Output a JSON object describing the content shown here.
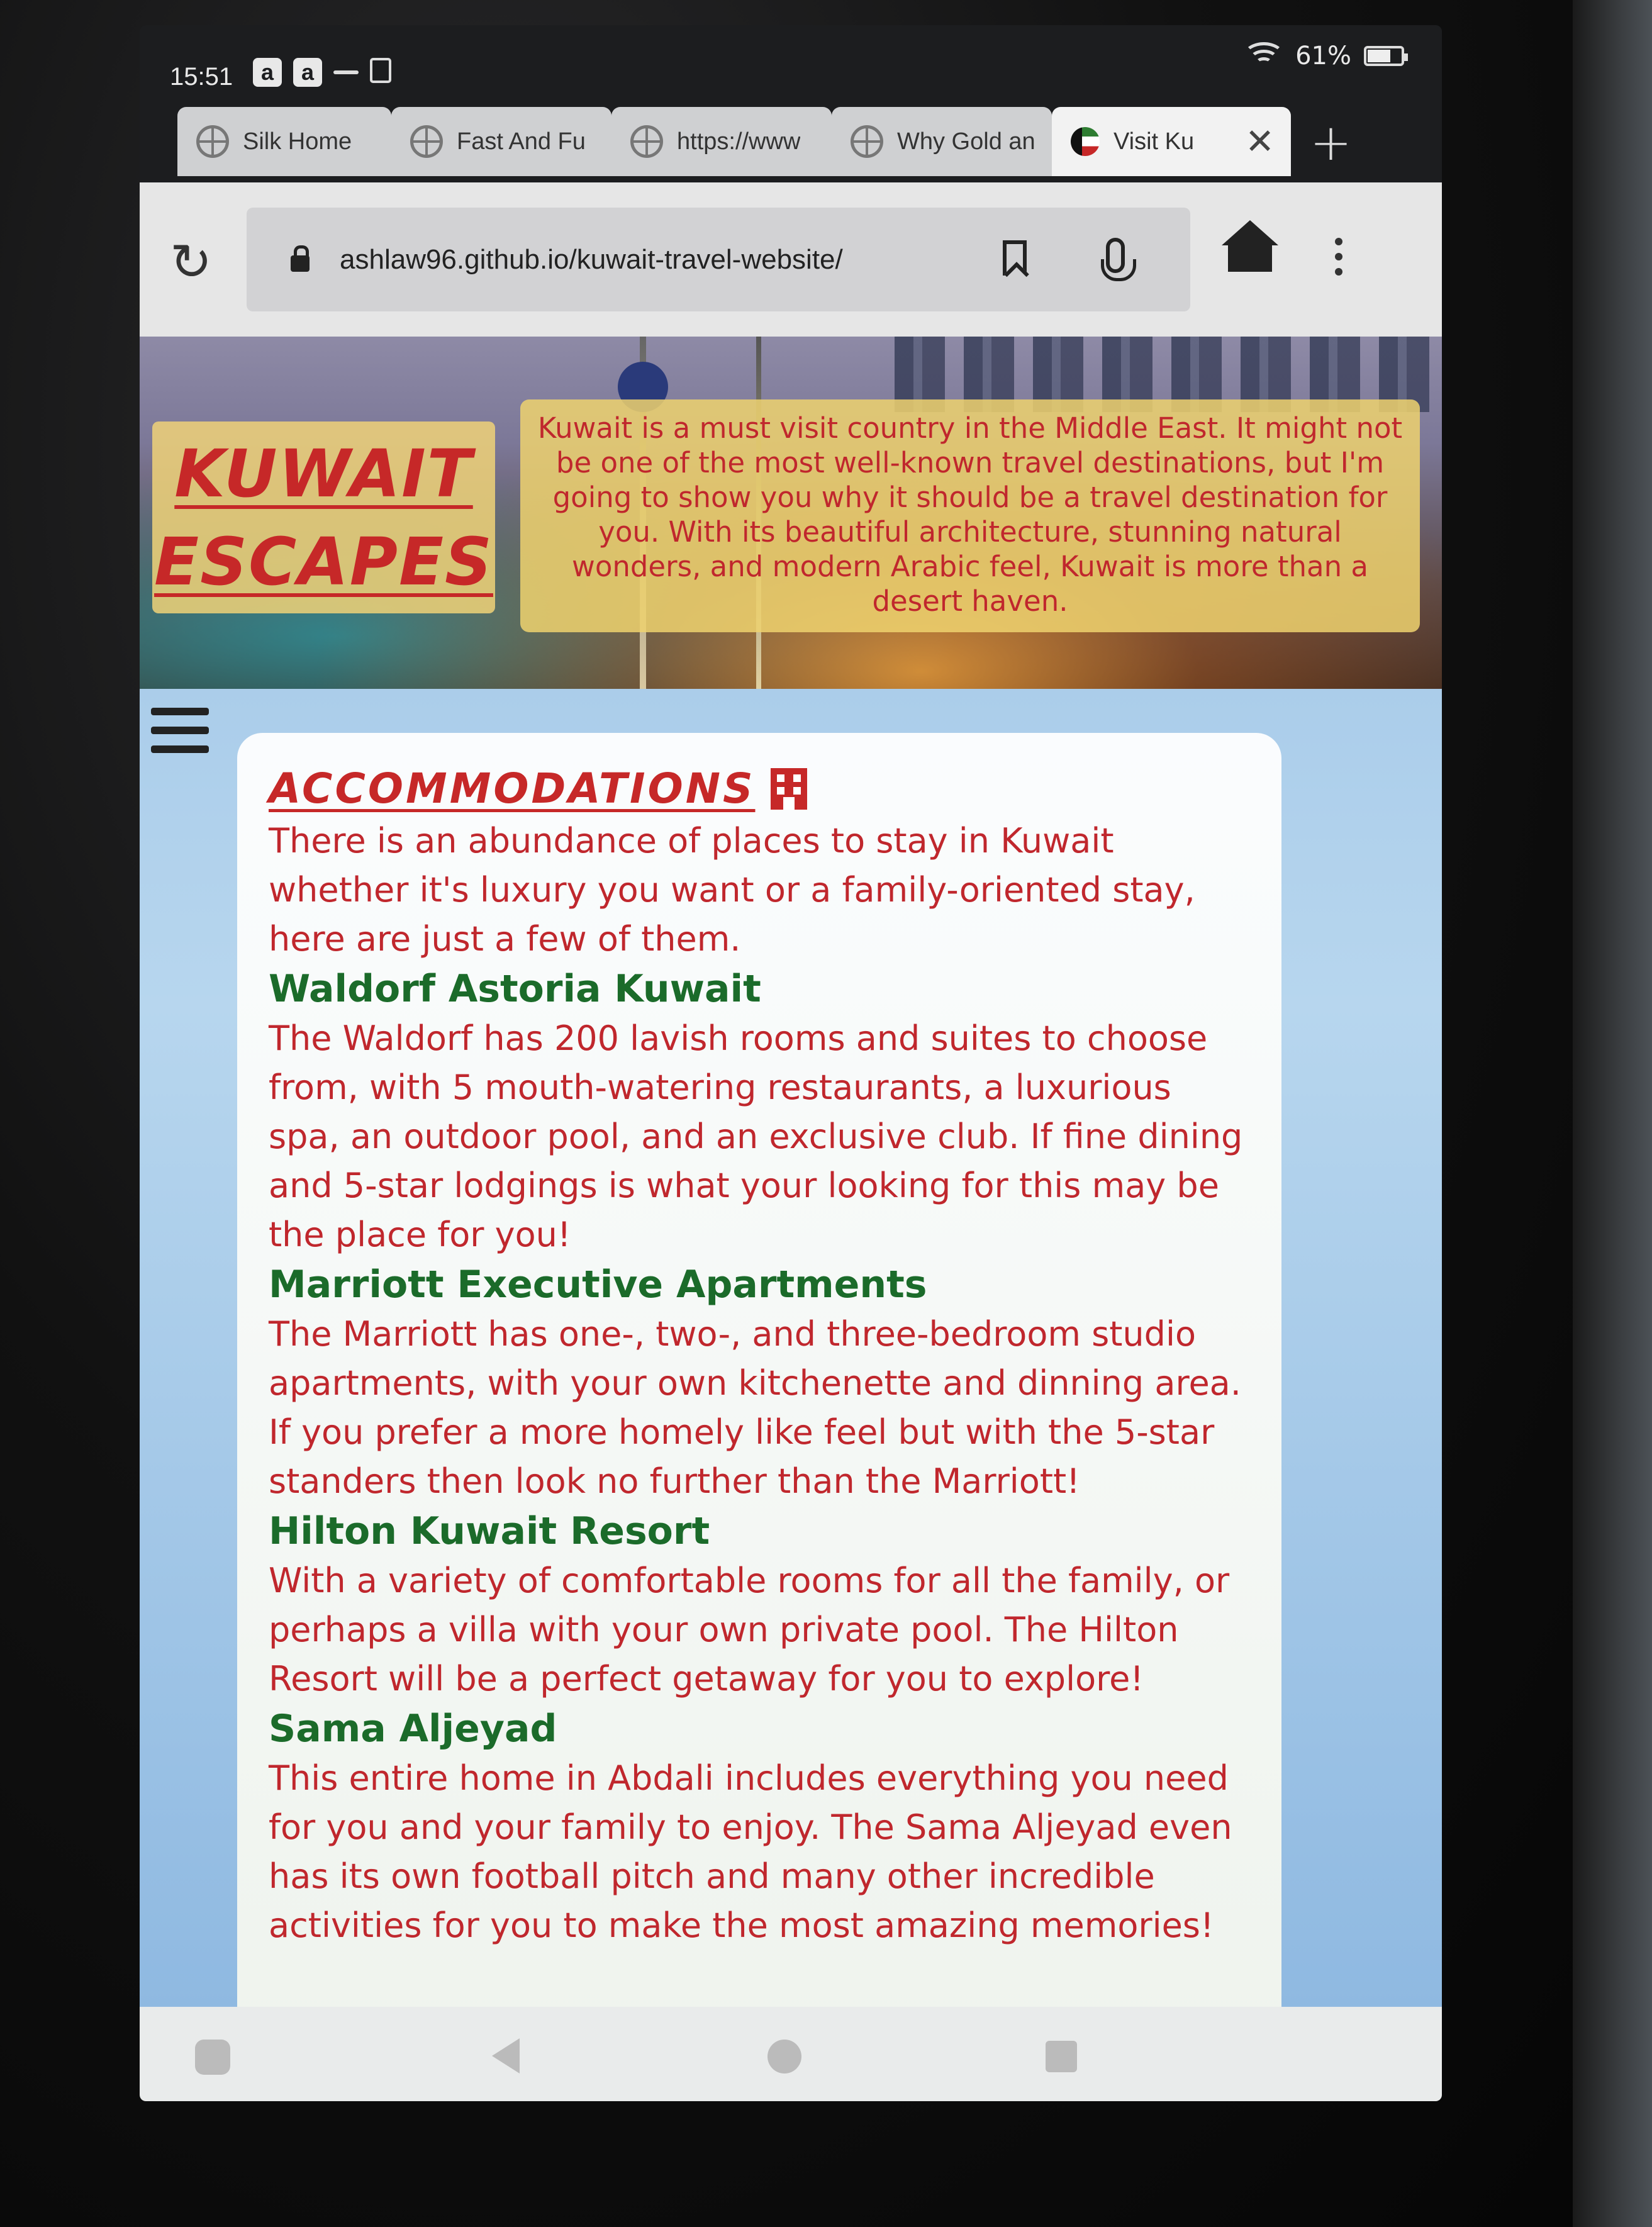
{
  "status_bar": {
    "time": "15:51",
    "notification_icons": [
      "a",
      "a"
    ],
    "battery": "61%"
  },
  "tabs": [
    {
      "title": "Silk Home",
      "icon": "globe-icon",
      "active": false
    },
    {
      "title": "Fast And Fu",
      "icon": "globe-icon",
      "active": false
    },
    {
      "title": "https://www",
      "icon": "globe-icon",
      "active": false
    },
    {
      "title": "Why Gold an",
      "icon": "globe-icon",
      "active": false
    },
    {
      "title": "Visit Ku",
      "icon": "kuwait-flag-icon",
      "active": true
    }
  ],
  "toolbar": {
    "url": "ashlaw96.github.io/kuwait-travel-website/"
  },
  "hero": {
    "logo_line_1": "KUWAIT",
    "logo_line_2": "ESCAPES",
    "intro": "Kuwait is a must visit country in the Middle East. It might not be one of the most well-known travel destinations, but I'm going to show you why it should be a travel destination for you. With its beautiful architecture, stunning natural wonders, and modern Arabic feel, Kuwait is more than a desert haven."
  },
  "content": {
    "title": "ACCOMMODATIONS",
    "intro": "There is an abundance of places to stay in Kuwait whether it's luxury you want or a family-oriented stay, here are just a few of them.",
    "hotels": [
      {
        "name": "Waldorf Astoria Kuwait",
        "description": "The Waldorf has 200 lavish rooms and suites to choose from, with 5 mouth-watering restaurants, a luxurious spa, an outdoor pool, and an exclusive club. If fine dining and 5-star lodgings is what your looking for this may be the place for you!"
      },
      {
        "name": "Marriott Executive Apartments",
        "description": "The Marriott has one-, two-, and three-bedroom studio apartments, with your own kitchenette and dinning area. If you prefer a more homely like feel but with the 5-star standers then look no further than the Marriott!"
      },
      {
        "name": "Hilton Kuwait Resort",
        "description": "With a variety of comfortable rooms for all the family, or perhaps a villa with your own private pool. The Hilton Resort will be a perfect getaway for you to explore!"
      },
      {
        "name": "Sama Aljeyad",
        "description": "This entire home in Abdali includes everything you need for you and your family to enjoy. The Sama Aljeyad even has its own football pitch and many other incredible activities for you to make the most amazing memories!"
      }
    ]
  },
  "colors": {
    "brand_red": "#c62828",
    "hotel_green": "#1b6b2a",
    "banner_yellow": "#eed26e",
    "page_blue": "#9dc3e6"
  }
}
